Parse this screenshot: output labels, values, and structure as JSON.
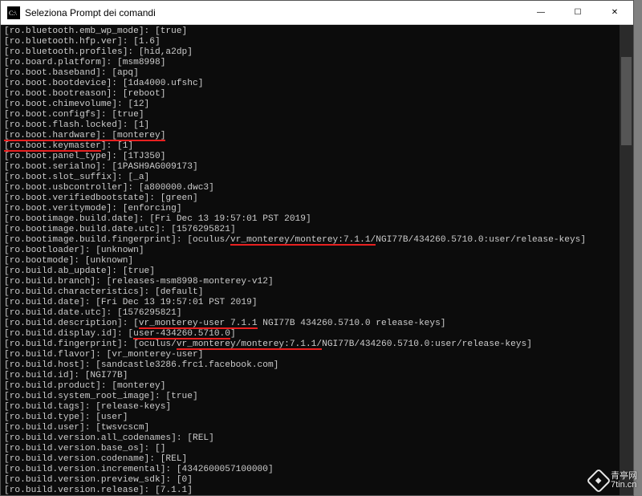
{
  "titlebar": {
    "icon_glyph": "C:\\",
    "title": "Seleziona Prompt dei comandi"
  },
  "window_controls": {
    "minimize": "—",
    "maximize": "☐",
    "close": "✕"
  },
  "terminal": {
    "lines": [
      {
        "key": "ro.bluetooth.emb_wp_mode",
        "val": "true"
      },
      {
        "key": "ro.bluetooth.hfp.ver",
        "val": "1.6"
      },
      {
        "key": "ro.bluetooth.profiles",
        "val": "hid,a2dp"
      },
      {
        "key": "ro.board.platform",
        "val": "msm8998"
      },
      {
        "key": "ro.boot.baseband",
        "val": "apq"
      },
      {
        "key": "ro.boot.bootdevice",
        "val": "1da4000.ufshc"
      },
      {
        "key": "ro.boot.bootreason",
        "val": "reboot"
      },
      {
        "key": "ro.boot.chimevolume",
        "val": "12"
      },
      {
        "key": "ro.boot.configfs",
        "val": "true"
      },
      {
        "key": "ro.boot.flash.locked",
        "val": "1"
      },
      {
        "key": "ro.boot.hardware",
        "val": "monterey",
        "underline_full": true
      },
      {
        "key": "ro.boot.keymaster",
        "val": "1",
        "underline_key": true
      },
      {
        "key": "ro.boot.panel_type",
        "val": "1TJ350"
      },
      {
        "key": "ro.boot.serialno",
        "val": "1PASH9AG009173"
      },
      {
        "key": "ro.boot.slot_suffix",
        "val": "_a"
      },
      {
        "key": "ro.boot.usbcontroller",
        "val": "a800000.dwc3"
      },
      {
        "key": "ro.boot.verifiedbootstate",
        "val": "green"
      },
      {
        "key": "ro.boot.veritymode",
        "val": "enforcing"
      },
      {
        "key": "ro.bootimage.build.date",
        "val": "Fri Dec 13 19:57:01 PST 2019"
      },
      {
        "key": "ro.bootimage.build.date.utc",
        "val": "1576295821"
      },
      {
        "key": "ro.bootimage.build.fingerprint",
        "pre": "oculus/",
        "mid": "vr_monterey/monterey:7.1.1/",
        "post": "NGI77B/434260.5710.0:user/release-keys",
        "underline_mid": true
      },
      {
        "key": "ro.bootloader",
        "val": "unknown"
      },
      {
        "key": "ro.bootmode",
        "val": "unknown"
      },
      {
        "key": "ro.build.ab_update",
        "val": "true"
      },
      {
        "key": "ro.build.branch",
        "val": "releases-msm8998-monterey-v12"
      },
      {
        "key": "ro.build.characteristics",
        "val": "default"
      },
      {
        "key": "ro.build.date",
        "val": "Fri Dec 13 19:57:01 PST 2019"
      },
      {
        "key": "ro.build.date.utc",
        "val": "1576295821"
      },
      {
        "key": "ro.build.description",
        "pre": "",
        "mid": "vr_monterey-user 7.1.1",
        "post": " NGI77B 434260.5710.0 release-keys",
        "underline_mid": true
      },
      {
        "key": "ro.build.display.id",
        "pre": "",
        "mid": "user-434260.5710.0",
        "post": "",
        "underline_mid": true
      },
      {
        "key": "ro.build.fingerprint",
        "pre": "oculus/",
        "mid": "vr_monterey/monterey:7.1.1/",
        "post": "NGI77B/434260.5710.0:user/release-keys",
        "underline_mid": true
      },
      {
        "key": "ro.build.flavor",
        "val": "vr_monterey-user"
      },
      {
        "key": "ro.build.host",
        "val": "sandcastle3286.frc1.facebook.com"
      },
      {
        "key": "ro.build.id",
        "val": "NGI77B"
      },
      {
        "key": "ro.build.product",
        "val": "monterey"
      },
      {
        "key": "ro.build.system_root_image",
        "val": "true"
      },
      {
        "key": "ro.build.tags",
        "val": "release-keys"
      },
      {
        "key": "ro.build.type",
        "val": "user"
      },
      {
        "key": "ro.build.user",
        "val": "twsvcscm"
      },
      {
        "key": "ro.build.version.all_codenames",
        "val": "REL"
      },
      {
        "key": "ro.build.version.base_os",
        "val": ""
      },
      {
        "key": "ro.build.version.codename",
        "val": "REL"
      },
      {
        "key": "ro.build.version.incremental",
        "val": "4342600057100000"
      },
      {
        "key": "ro.build.version.preview_sdk",
        "val": "0"
      },
      {
        "key": "ro.build.version.release",
        "val": "7.1.1"
      }
    ]
  },
  "watermark": {
    "line1": "青亭网",
    "line2": "7tin.cn"
  }
}
